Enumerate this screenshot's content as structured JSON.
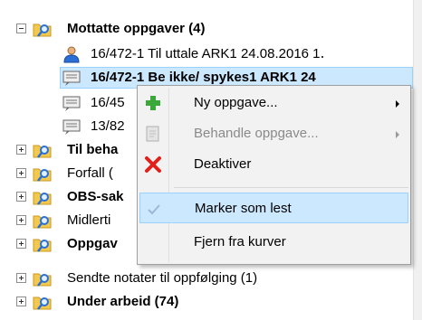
{
  "tree": {
    "root": {
      "label": "Mottatte oppgaver (4)"
    },
    "children": [
      {
        "label": "16/472-1 Til uttale ARK1  24.08.2016 1․",
        "icon": "person-icon"
      },
      {
        "label": "16/472-1 Be ikke/ spykes1 ARK1 24",
        "icon": "document-icon",
        "selected": true
      },
      {
        "label": "16/45",
        "icon": "document-icon"
      },
      {
        "label": "13/82",
        "icon": "document-icon"
      }
    ],
    "folders": [
      {
        "label": "Til beha",
        "bold": true
      },
      {
        "label": "Forfall (",
        "bold": false
      },
      {
        "label": "OBS-sak",
        "bold": true
      },
      {
        "label": "Midlerti",
        "bold": false
      },
      {
        "label": "Oppgav",
        "bold": true
      },
      {
        "label": "Sendte notater til oppfølging (1)",
        "bold": false
      },
      {
        "label": "Under arbeid (74)",
        "bold": true
      }
    ]
  },
  "context_menu": {
    "items": [
      {
        "label": "Ny oppgave...",
        "icon": "plus-icon",
        "submenu": true,
        "disabled": false
      },
      {
        "label": "Behandle oppgave...",
        "icon": "document-edit-icon",
        "submenu": true,
        "disabled": true
      },
      {
        "label": "Deaktiver",
        "icon": "red-x-icon",
        "submenu": false,
        "disabled": false
      },
      {
        "label": "Marker som lest",
        "icon": "checkmark-icon",
        "submenu": false,
        "disabled": false,
        "hover": true
      },
      {
        "label": "Fjern fra kurver",
        "icon": "",
        "submenu": false,
        "disabled": false
      }
    ]
  },
  "colors": {
    "selection": "#cce8ff",
    "selection_border": "#99d1ff",
    "menu_bg": "#f2f2f2",
    "plus_green": "#3aa93a",
    "red_x": "#e0201b",
    "folder_yellow": "#f3c94d",
    "magnifier_blue": "#2a6fd6"
  }
}
